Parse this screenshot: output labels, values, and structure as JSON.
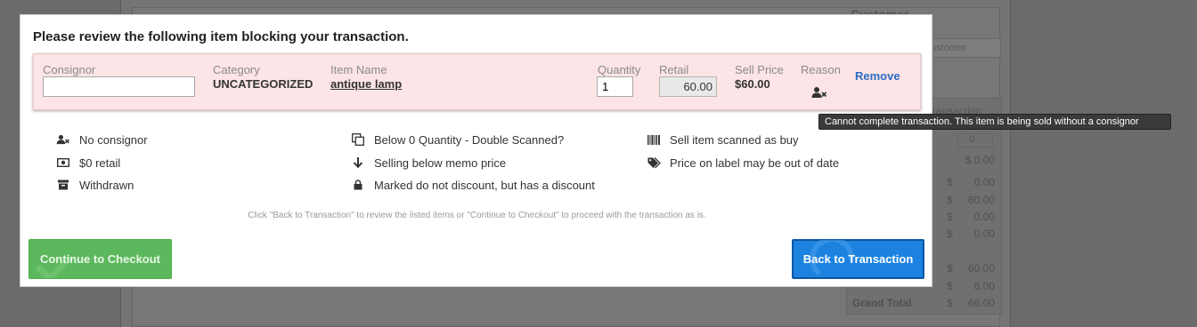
{
  "background": {
    "customer_label": "Customer",
    "customer_placeholder": "Customer",
    "summary_header": "Transaction",
    "qty_value": "0",
    "rows": [
      {
        "label": "",
        "cur": "",
        "amount": "$ 0.00"
      },
      {
        "label": "",
        "cur": "$",
        "amount": "0.00"
      },
      {
        "label": "",
        "cur": "$",
        "amount": "60.00"
      },
      {
        "label": "",
        "cur": "$",
        "amount": "0.00"
      },
      {
        "label": "",
        "cur": "$",
        "amount": "0.00"
      },
      {
        "label": "",
        "cur": "$",
        "amount": "60.00"
      },
      {
        "label": "",
        "cur": "$",
        "amount": "6.00"
      },
      {
        "label": "Grand Total",
        "cur": "$",
        "amount": "66.00"
      }
    ]
  },
  "modal": {
    "title": "Please review the following item blocking your transaction.",
    "columns": {
      "consignor": "Consignor",
      "category": "Category",
      "item_name": "Item Name",
      "quantity": "Quantity",
      "retail": "Retail",
      "sell_price": "Sell Price",
      "reason": "Reason"
    },
    "item": {
      "consignor_value": "",
      "category": "UNCATEGORIZED",
      "item_name": "antique lamp",
      "quantity": "1",
      "retail": "60.00",
      "sell_price": "$60.00",
      "reason_icon": "user-x-icon"
    },
    "remove_label": "Remove",
    "tooltip": "Cannot complete transaction. This item is being sold without a consignor",
    "legend": [
      {
        "icon": "user-x-icon",
        "label": "No consignor"
      },
      {
        "icon": "money-icon",
        "label": "$0 retail"
      },
      {
        "icon": "archive-icon",
        "label": "Withdrawn"
      },
      {
        "icon": "copy-icon",
        "label": "Below 0 Quantity - Double Scanned?"
      },
      {
        "icon": "arrow-down-icon",
        "label": "Selling below memo price"
      },
      {
        "icon": "lock-icon",
        "label": "Marked do not discount, but has a discount"
      },
      {
        "icon": "barcode-icon",
        "label": "Sell item scanned as buy"
      },
      {
        "icon": "tags-icon",
        "label": "Price on label may be out of date"
      }
    ],
    "footer_note": "Click \"Back to Transaction\" to review the listed items or \"Continue to Checkout\" to proceed with the transaction as is.",
    "continue_label": "Continue to Checkout",
    "back_label": "Back to Transaction"
  },
  "colors": {
    "continue_button": "#5cb85c",
    "back_button": "#1b82e0",
    "row_highlight": "#fde4e6",
    "remove_link": "#2b6cc4"
  }
}
